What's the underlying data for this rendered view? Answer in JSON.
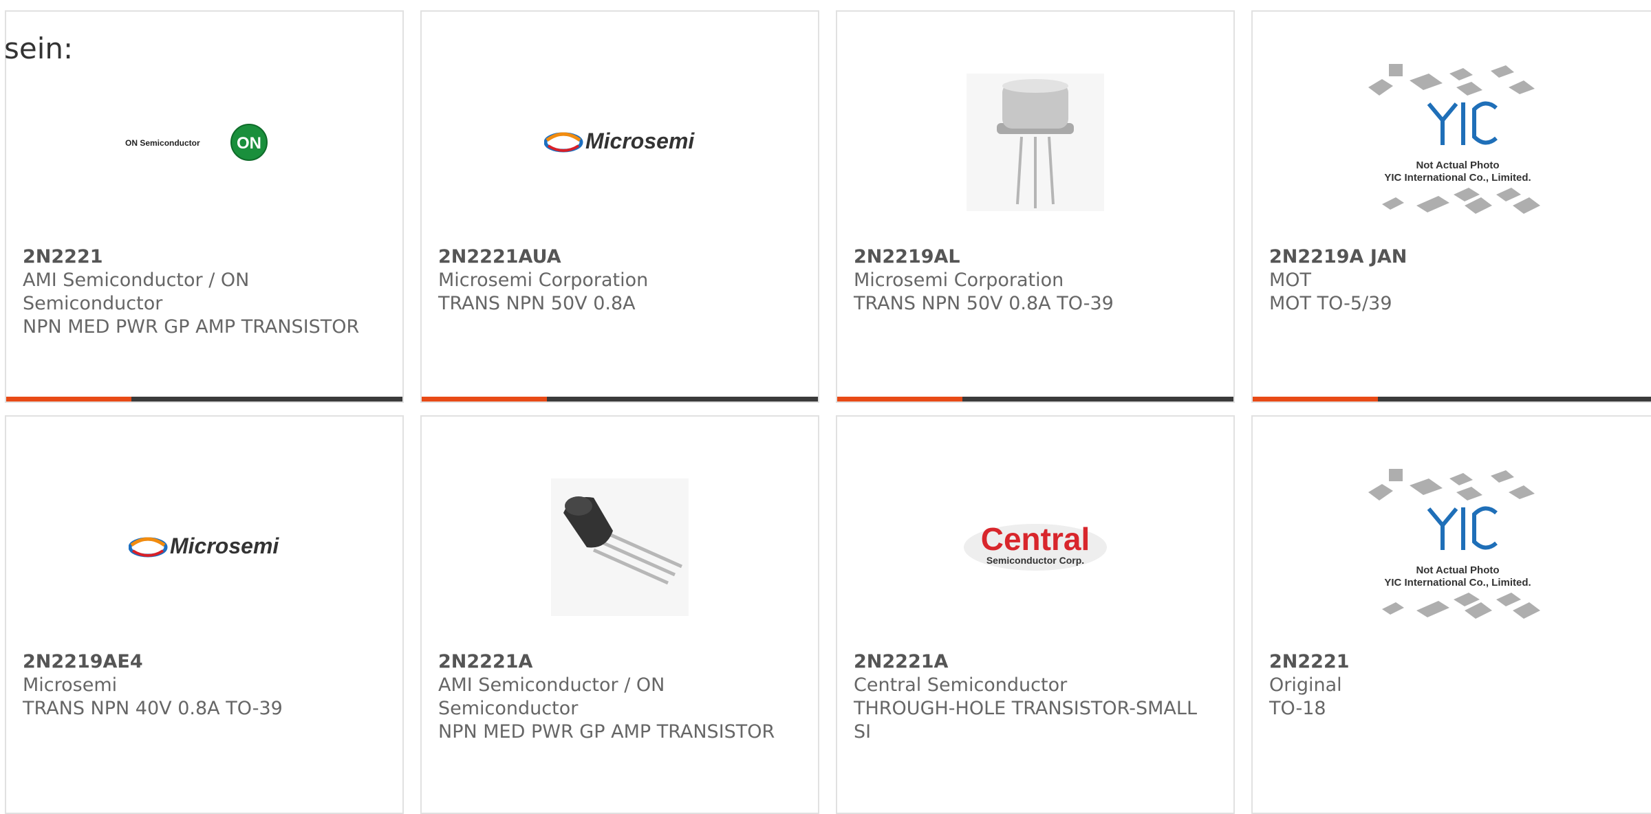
{
  "intro_text": "sein:",
  "accent_color": "#e84a16",
  "bar_color": "#3b3b3b",
  "products": [
    {
      "part": "2N2221",
      "manufacturer": "AMI Semiconductor / ON Semiconductor",
      "description": "NPN MED PWR GP AMP TRANSISTOR",
      "image": "on-semiconductor-logo",
      "logo_text": "ON Semiconductor",
      "logo_badge": "ON"
    },
    {
      "part": "2N2221AUA",
      "manufacturer": "Microsemi Corporation",
      "description": "TRANS NPN 50V 0.8A",
      "image": "microsemi-logo",
      "logo_text": "Microsemi"
    },
    {
      "part": "2N2219AL",
      "manufacturer": "Microsemi Corporation",
      "description": "TRANS NPN 50V 0.8A TO-39",
      "image": "to39-metal-can-photo"
    },
    {
      "part": "2N2219A JAN",
      "manufacturer": "MOT",
      "description": "MOT TO-5/39",
      "image": "yic-placeholder",
      "logo_text": "YIC",
      "caption_1": "Not Actual Photo",
      "caption_2": "YIC International Co., Limited."
    },
    {
      "part": "2N2219AE4",
      "manufacturer": "Microsemi",
      "description": "TRANS NPN 40V 0.8A TO-39",
      "image": "microsemi-logo",
      "logo_text": "Microsemi"
    },
    {
      "part": "2N2221A",
      "manufacturer": "AMI Semiconductor / ON Semiconductor",
      "description": "NPN MED PWR GP AMP TRANSISTOR",
      "image": "to92-transistor-photo"
    },
    {
      "part": "2N2221A",
      "manufacturer": "Central Semiconductor",
      "description": "THROUGH-HOLE TRANSISTOR-SMALL SI",
      "image": "central-semiconductor-logo",
      "logo_text": "Central",
      "logo_subtext": "Semiconductor Corp."
    },
    {
      "part": "2N2221",
      "manufacturer": "Original",
      "description": "TO-18",
      "image": "yic-placeholder",
      "logo_text": "YIC",
      "caption_1": "Not Actual Photo",
      "caption_2": "YIC International Co., Limited."
    }
  ]
}
